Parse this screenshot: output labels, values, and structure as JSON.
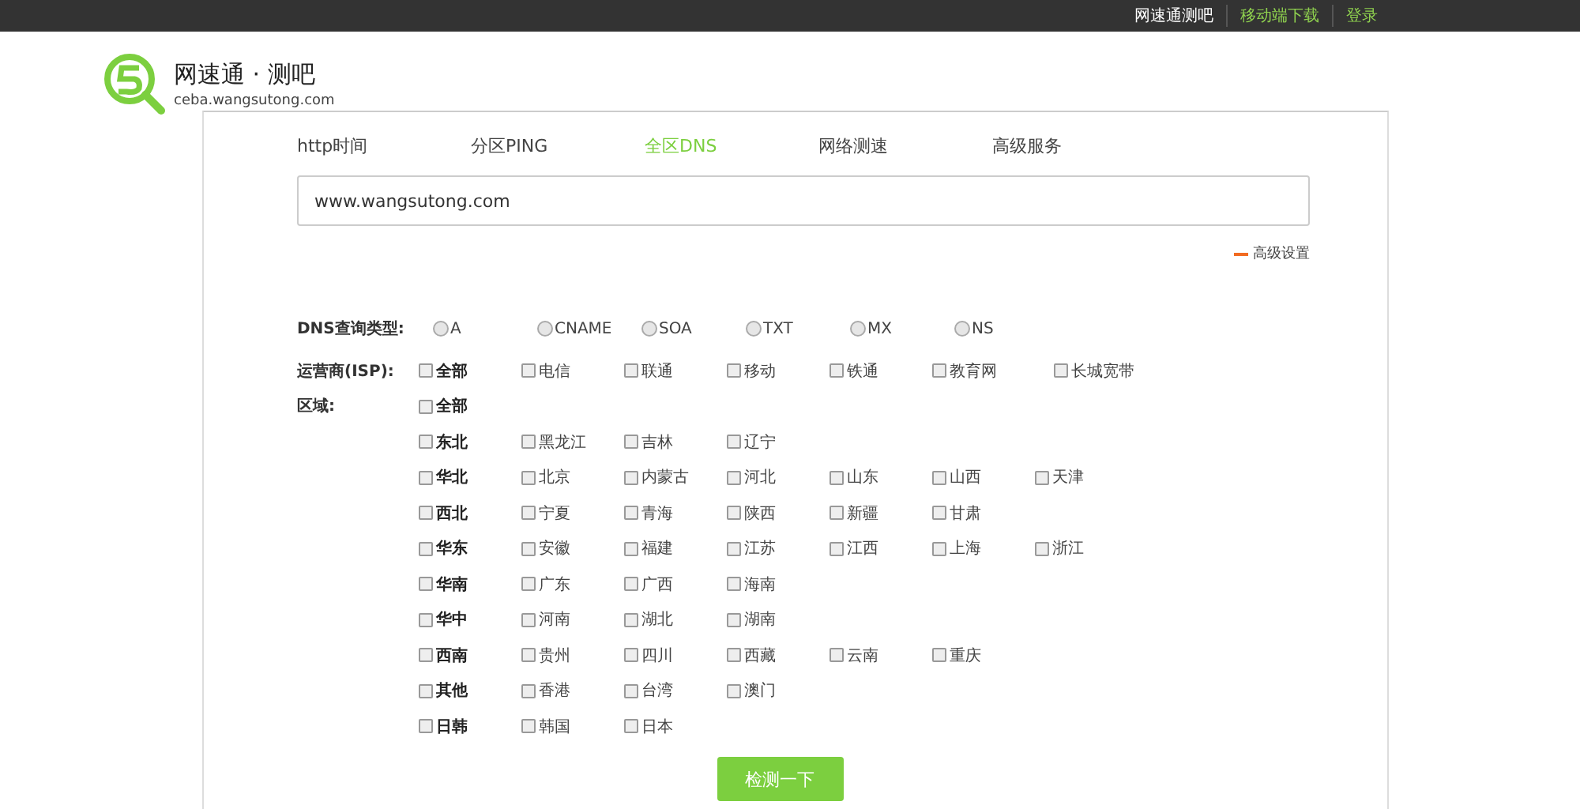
{
  "top_links": [
    {
      "label": "网速通测吧",
      "kind": "current"
    },
    {
      "label": "移动端下载",
      "kind": "link"
    },
    {
      "label": "登录",
      "kind": "link"
    }
  ],
  "logo": {
    "title": "网速通 · 测吧",
    "domain": "ceba.wangsutong.com"
  },
  "tabs": [
    {
      "label": "http时间",
      "selected": false
    },
    {
      "label": "分区PING",
      "selected": false
    },
    {
      "label": "全区DNS",
      "selected": true
    },
    {
      "label": "网络测速",
      "selected": false
    },
    {
      "label": "高级服务",
      "selected": false
    }
  ],
  "search": {
    "value": "www.wangsutong.com"
  },
  "advanced": {
    "label": "高级设置",
    "expanded": true
  },
  "dns_type": {
    "label": "DNS查询类型:",
    "options": [
      {
        "label": "A",
        "selected": false
      },
      {
        "label": "CNAME",
        "selected": false
      },
      {
        "label": "SOA",
        "selected": false
      },
      {
        "label": "TXT",
        "selected": false
      },
      {
        "label": "MX",
        "selected": false
      },
      {
        "label": "NS",
        "selected": false
      }
    ]
  },
  "isp": {
    "label": "运营商(ISP):",
    "options": [
      {
        "label": "全部",
        "kind": "all",
        "checked": false
      },
      {
        "label": "电信",
        "kind": "item",
        "checked": false
      },
      {
        "label": "联通",
        "kind": "item",
        "checked": false
      },
      {
        "label": "移动",
        "kind": "item",
        "checked": false
      },
      {
        "label": "铁通",
        "kind": "item",
        "checked": false
      },
      {
        "label": "教育网",
        "kind": "item",
        "checked": false
      },
      {
        "label": "长城宽带",
        "kind": "item",
        "checked": false
      }
    ]
  },
  "region": {
    "label": "区域:",
    "all": {
      "label": "全部",
      "checked": false
    },
    "groups": [
      {
        "label": "东北",
        "checked": false,
        "items": [
          {
            "label": "黑龙江",
            "checked": false
          },
          {
            "label": "吉林",
            "checked": false
          },
          {
            "label": "辽宁",
            "checked": false
          }
        ]
      },
      {
        "label": "华北",
        "checked": false,
        "items": [
          {
            "label": "北京",
            "checked": false
          },
          {
            "label": "内蒙古",
            "checked": false
          },
          {
            "label": "河北",
            "checked": false
          },
          {
            "label": "山东",
            "checked": false
          },
          {
            "label": "山西",
            "checked": false
          },
          {
            "label": "天津",
            "checked": false
          }
        ]
      },
      {
        "label": "西北",
        "checked": false,
        "items": [
          {
            "label": "宁夏",
            "checked": false
          },
          {
            "label": "青海",
            "checked": false
          },
          {
            "label": "陕西",
            "checked": false
          },
          {
            "label": "新疆",
            "checked": false
          },
          {
            "label": "甘肃",
            "checked": false
          }
        ]
      },
      {
        "label": "华东",
        "checked": false,
        "items": [
          {
            "label": "安徽",
            "checked": false
          },
          {
            "label": "福建",
            "checked": false
          },
          {
            "label": "江苏",
            "checked": false
          },
          {
            "label": "江西",
            "checked": false
          },
          {
            "label": "上海",
            "checked": false
          },
          {
            "label": "浙江",
            "checked": false
          }
        ]
      },
      {
        "label": "华南",
        "checked": false,
        "items": [
          {
            "label": "广东",
            "checked": false
          },
          {
            "label": "广西",
            "checked": false
          },
          {
            "label": "海南",
            "checked": false
          }
        ]
      },
      {
        "label": "华中",
        "checked": false,
        "items": [
          {
            "label": "河南",
            "checked": false
          },
          {
            "label": "湖北",
            "checked": false
          },
          {
            "label": "湖南",
            "checked": false
          }
        ]
      },
      {
        "label": "西南",
        "checked": false,
        "items": [
          {
            "label": "贵州",
            "checked": false
          },
          {
            "label": "四川",
            "checked": false
          },
          {
            "label": "西藏",
            "checked": false
          },
          {
            "label": "云南",
            "checked": false
          },
          {
            "label": "重庆",
            "checked": false
          }
        ]
      },
      {
        "label": "其他",
        "checked": false,
        "items": [
          {
            "label": "香港",
            "checked": false
          },
          {
            "label": "台湾",
            "checked": false
          },
          {
            "label": "澳门",
            "checked": false
          }
        ]
      },
      {
        "label": "日韩",
        "checked": false,
        "items": [
          {
            "label": "韩国",
            "checked": false
          },
          {
            "label": "日本",
            "checked": false
          }
        ]
      }
    ]
  },
  "submit": {
    "label": "检测一下"
  }
}
